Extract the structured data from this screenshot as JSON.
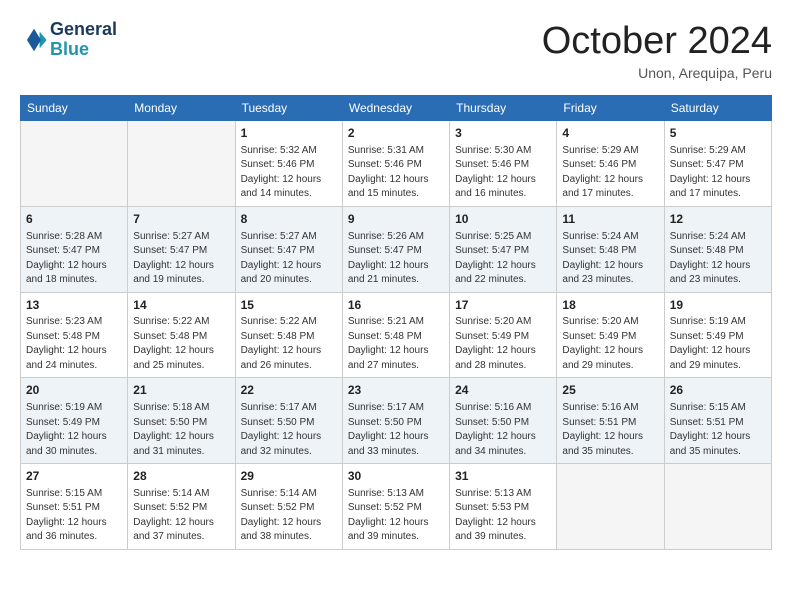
{
  "logo": {
    "line1": "General",
    "line2": "Blue"
  },
  "title": "October 2024",
  "subtitle": "Unon, Arequipa, Peru",
  "days_of_week": [
    "Sunday",
    "Monday",
    "Tuesday",
    "Wednesday",
    "Thursday",
    "Friday",
    "Saturday"
  ],
  "weeks": [
    [
      {
        "day": "",
        "sunrise": "",
        "sunset": "",
        "daylight": ""
      },
      {
        "day": "",
        "sunrise": "",
        "sunset": "",
        "daylight": ""
      },
      {
        "day": "1",
        "sunrise": "Sunrise: 5:32 AM",
        "sunset": "Sunset: 5:46 PM",
        "daylight": "Daylight: 12 hours and 14 minutes."
      },
      {
        "day": "2",
        "sunrise": "Sunrise: 5:31 AM",
        "sunset": "Sunset: 5:46 PM",
        "daylight": "Daylight: 12 hours and 15 minutes."
      },
      {
        "day": "3",
        "sunrise": "Sunrise: 5:30 AM",
        "sunset": "Sunset: 5:46 PM",
        "daylight": "Daylight: 12 hours and 16 minutes."
      },
      {
        "day": "4",
        "sunrise": "Sunrise: 5:29 AM",
        "sunset": "Sunset: 5:46 PM",
        "daylight": "Daylight: 12 hours and 17 minutes."
      },
      {
        "day": "5",
        "sunrise": "Sunrise: 5:29 AM",
        "sunset": "Sunset: 5:47 PM",
        "daylight": "Daylight: 12 hours and 17 minutes."
      }
    ],
    [
      {
        "day": "6",
        "sunrise": "Sunrise: 5:28 AM",
        "sunset": "Sunset: 5:47 PM",
        "daylight": "Daylight: 12 hours and 18 minutes."
      },
      {
        "day": "7",
        "sunrise": "Sunrise: 5:27 AM",
        "sunset": "Sunset: 5:47 PM",
        "daylight": "Daylight: 12 hours and 19 minutes."
      },
      {
        "day": "8",
        "sunrise": "Sunrise: 5:27 AM",
        "sunset": "Sunset: 5:47 PM",
        "daylight": "Daylight: 12 hours and 20 minutes."
      },
      {
        "day": "9",
        "sunrise": "Sunrise: 5:26 AM",
        "sunset": "Sunset: 5:47 PM",
        "daylight": "Daylight: 12 hours and 21 minutes."
      },
      {
        "day": "10",
        "sunrise": "Sunrise: 5:25 AM",
        "sunset": "Sunset: 5:47 PM",
        "daylight": "Daylight: 12 hours and 22 minutes."
      },
      {
        "day": "11",
        "sunrise": "Sunrise: 5:24 AM",
        "sunset": "Sunset: 5:48 PM",
        "daylight": "Daylight: 12 hours and 23 minutes."
      },
      {
        "day": "12",
        "sunrise": "Sunrise: 5:24 AM",
        "sunset": "Sunset: 5:48 PM",
        "daylight": "Daylight: 12 hours and 23 minutes."
      }
    ],
    [
      {
        "day": "13",
        "sunrise": "Sunrise: 5:23 AM",
        "sunset": "Sunset: 5:48 PM",
        "daylight": "Daylight: 12 hours and 24 minutes."
      },
      {
        "day": "14",
        "sunrise": "Sunrise: 5:22 AM",
        "sunset": "Sunset: 5:48 PM",
        "daylight": "Daylight: 12 hours and 25 minutes."
      },
      {
        "day": "15",
        "sunrise": "Sunrise: 5:22 AM",
        "sunset": "Sunset: 5:48 PM",
        "daylight": "Daylight: 12 hours and 26 minutes."
      },
      {
        "day": "16",
        "sunrise": "Sunrise: 5:21 AM",
        "sunset": "Sunset: 5:48 PM",
        "daylight": "Daylight: 12 hours and 27 minutes."
      },
      {
        "day": "17",
        "sunrise": "Sunrise: 5:20 AM",
        "sunset": "Sunset: 5:49 PM",
        "daylight": "Daylight: 12 hours and 28 minutes."
      },
      {
        "day": "18",
        "sunrise": "Sunrise: 5:20 AM",
        "sunset": "Sunset: 5:49 PM",
        "daylight": "Daylight: 12 hours and 29 minutes."
      },
      {
        "day": "19",
        "sunrise": "Sunrise: 5:19 AM",
        "sunset": "Sunset: 5:49 PM",
        "daylight": "Daylight: 12 hours and 29 minutes."
      }
    ],
    [
      {
        "day": "20",
        "sunrise": "Sunrise: 5:19 AM",
        "sunset": "Sunset: 5:49 PM",
        "daylight": "Daylight: 12 hours and 30 minutes."
      },
      {
        "day": "21",
        "sunrise": "Sunrise: 5:18 AM",
        "sunset": "Sunset: 5:50 PM",
        "daylight": "Daylight: 12 hours and 31 minutes."
      },
      {
        "day": "22",
        "sunrise": "Sunrise: 5:17 AM",
        "sunset": "Sunset: 5:50 PM",
        "daylight": "Daylight: 12 hours and 32 minutes."
      },
      {
        "day": "23",
        "sunrise": "Sunrise: 5:17 AM",
        "sunset": "Sunset: 5:50 PM",
        "daylight": "Daylight: 12 hours and 33 minutes."
      },
      {
        "day": "24",
        "sunrise": "Sunrise: 5:16 AM",
        "sunset": "Sunset: 5:50 PM",
        "daylight": "Daylight: 12 hours and 34 minutes."
      },
      {
        "day": "25",
        "sunrise": "Sunrise: 5:16 AM",
        "sunset": "Sunset: 5:51 PM",
        "daylight": "Daylight: 12 hours and 35 minutes."
      },
      {
        "day": "26",
        "sunrise": "Sunrise: 5:15 AM",
        "sunset": "Sunset: 5:51 PM",
        "daylight": "Daylight: 12 hours and 35 minutes."
      }
    ],
    [
      {
        "day": "27",
        "sunrise": "Sunrise: 5:15 AM",
        "sunset": "Sunset: 5:51 PM",
        "daylight": "Daylight: 12 hours and 36 minutes."
      },
      {
        "day": "28",
        "sunrise": "Sunrise: 5:14 AM",
        "sunset": "Sunset: 5:52 PM",
        "daylight": "Daylight: 12 hours and 37 minutes."
      },
      {
        "day": "29",
        "sunrise": "Sunrise: 5:14 AM",
        "sunset": "Sunset: 5:52 PM",
        "daylight": "Daylight: 12 hours and 38 minutes."
      },
      {
        "day": "30",
        "sunrise": "Sunrise: 5:13 AM",
        "sunset": "Sunset: 5:52 PM",
        "daylight": "Daylight: 12 hours and 39 minutes."
      },
      {
        "day": "31",
        "sunrise": "Sunrise: 5:13 AM",
        "sunset": "Sunset: 5:53 PM",
        "daylight": "Daylight: 12 hours and 39 minutes."
      },
      {
        "day": "",
        "sunrise": "",
        "sunset": "",
        "daylight": ""
      },
      {
        "day": "",
        "sunrise": "",
        "sunset": "",
        "daylight": ""
      }
    ]
  ]
}
